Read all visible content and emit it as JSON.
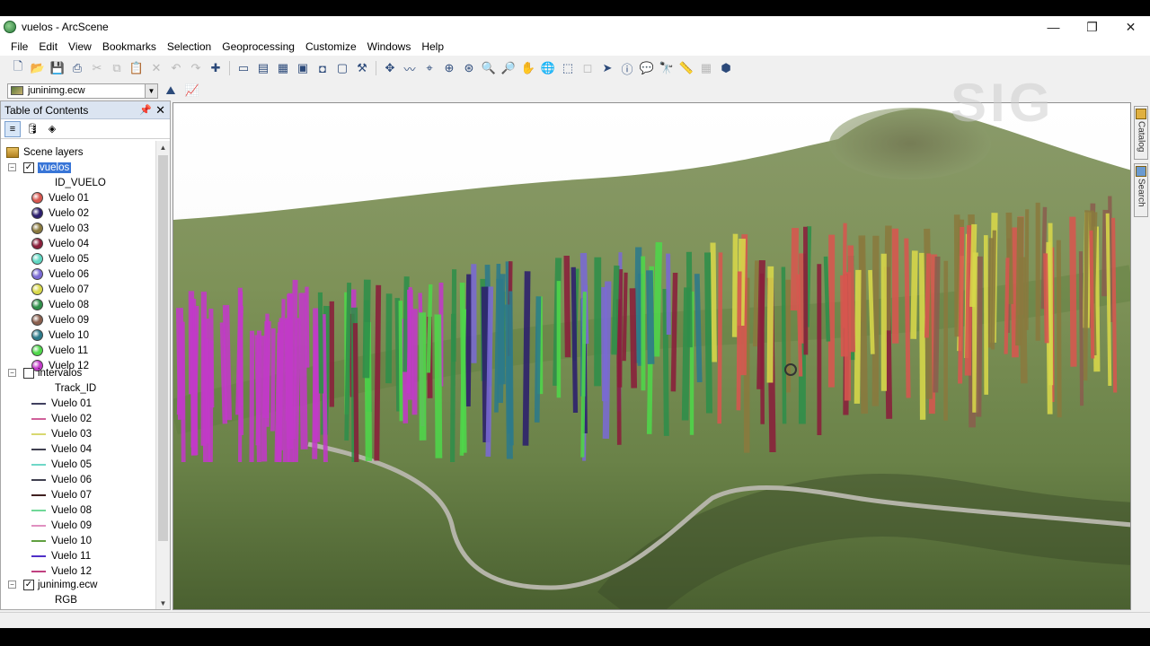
{
  "window": {
    "title": "vuelos - ArcScene",
    "controls": [
      "—",
      "❐",
      "✕"
    ]
  },
  "menu": [
    "File",
    "Edit",
    "View",
    "Bookmarks",
    "Selection",
    "Geoprocessing",
    "Customize",
    "Windows",
    "Help"
  ],
  "toolbar2": {
    "layer": "juninimg.ecw"
  },
  "toc": {
    "title": "Table of Contents",
    "root": "Scene layers",
    "vuelos_layer": "vuelos",
    "vuelos_field": "ID_VUELO",
    "vuelos_items": [
      {
        "label": "Vuelo 01",
        "color": "#d7574f"
      },
      {
        "label": "Vuelo 02",
        "color": "#2c1f6e"
      },
      {
        "label": "Vuelo 03",
        "color": "#8a7a3e"
      },
      {
        "label": "Vuelo 04",
        "color": "#8a1f3b"
      },
      {
        "label": "Vuelo 05",
        "color": "#5fd7c2"
      },
      {
        "label": "Vuelo 06",
        "color": "#7a6ad4"
      },
      {
        "label": "Vuelo 07",
        "color": "#d8d84a"
      },
      {
        "label": "Vuelo 08",
        "color": "#2f8f4a"
      },
      {
        "label": "Vuelo 09",
        "color": "#8a5f4e"
      },
      {
        "label": "Vuelo 10",
        "color": "#2d7a8a"
      },
      {
        "label": "Vuelo 11",
        "color": "#4fd74a"
      },
      {
        "label": "Vuelo 12",
        "color": "#c23ac8"
      }
    ],
    "intervalos_layer": "intervalos",
    "intervalos_field": "Track_ID",
    "intervalos_items": [
      {
        "label": "Vuelo 01",
        "color": "#404060"
      },
      {
        "label": "Vuelo 02",
        "color": "#d0609a"
      },
      {
        "label": "Vuelo 03",
        "color": "#d8d870"
      },
      {
        "label": "Vuelo 04",
        "color": "#404050"
      },
      {
        "label": "Vuelo 05",
        "color": "#70d8c8"
      },
      {
        "label": "Vuelo 06",
        "color": "#404050"
      },
      {
        "label": "Vuelo 07",
        "color": "#402020"
      },
      {
        "label": "Vuelo 08",
        "color": "#70d898"
      },
      {
        "label": "Vuelo 09",
        "color": "#e090c0"
      },
      {
        "label": "Vuelo 10",
        "color": "#60a040"
      },
      {
        "label": "Vuelo 11",
        "color": "#5030c8"
      },
      {
        "label": "Vuelo 12",
        "color": "#c04080"
      }
    ],
    "raster_layer": "juninimg.ecw",
    "raster_band": "RGB"
  },
  "right_tabs": [
    "Catalog",
    "Search"
  ],
  "watermark": "SIG"
}
